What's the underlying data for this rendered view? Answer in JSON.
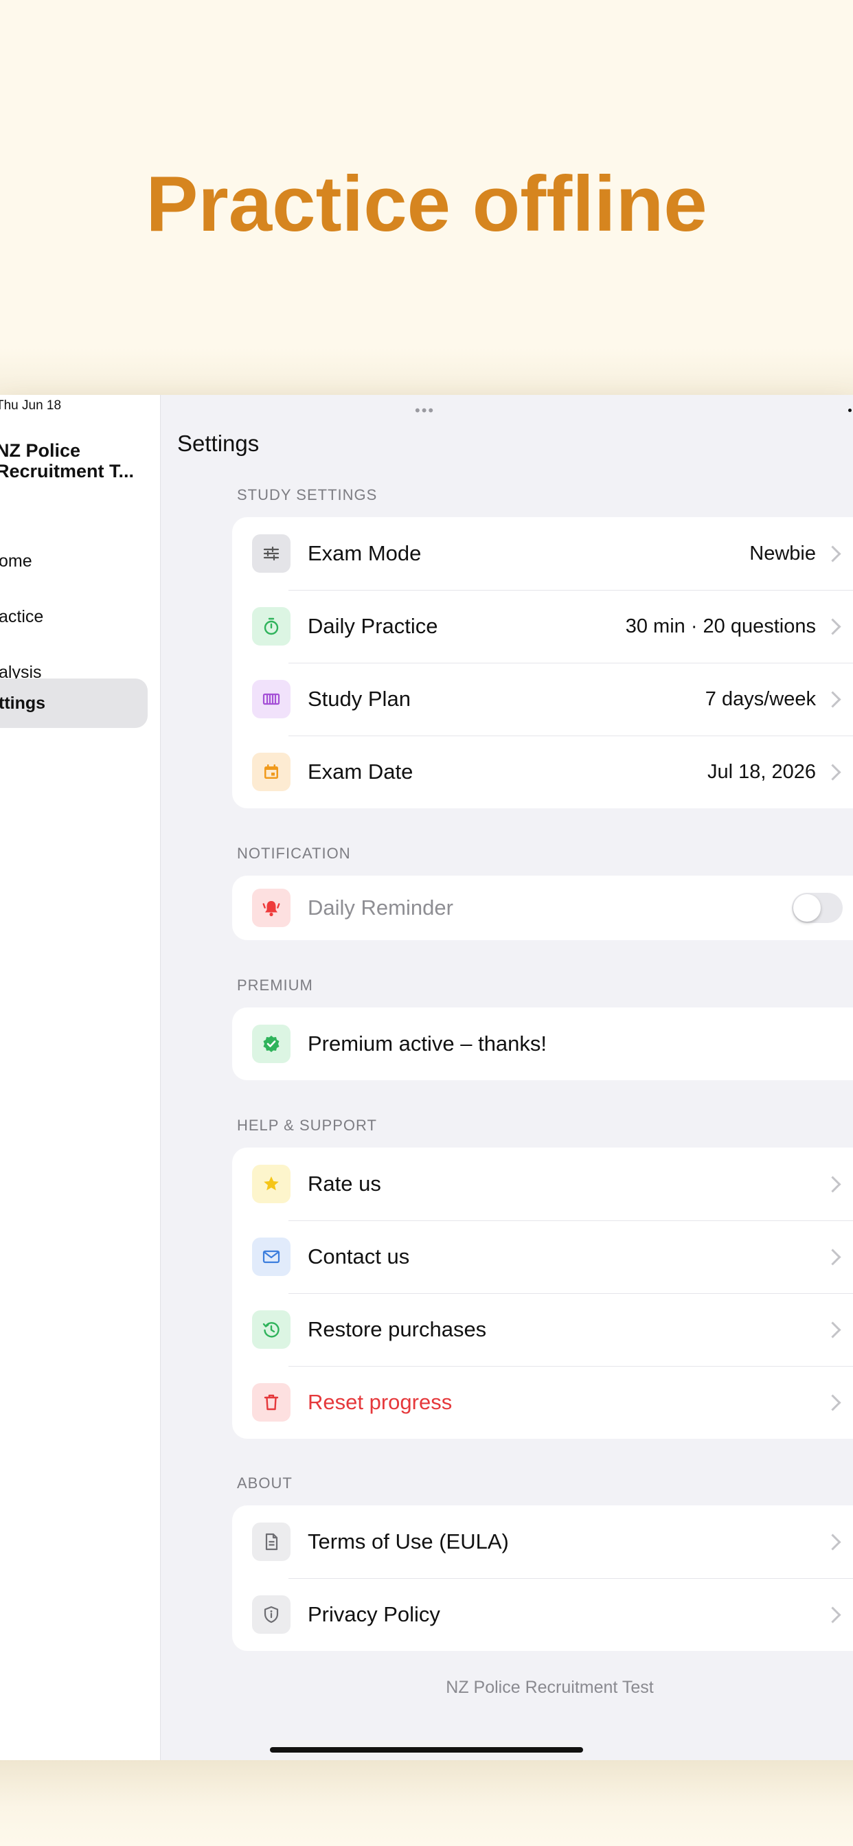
{
  "hero": {
    "title": "Practice offline"
  },
  "status": {
    "date": "Thu Jun 18"
  },
  "sidebar": {
    "app_title": "NZ Police Recruitment T...",
    "items": [
      {
        "label": "ome"
      },
      {
        "label": "actice"
      },
      {
        "label": "alysis"
      },
      {
        "label": "ttings"
      }
    ]
  },
  "main": {
    "title": "Settings",
    "sections": {
      "study": {
        "header": "STUDY SETTINGS",
        "rows": [
          {
            "label": "Exam Mode",
            "value": "Newbie",
            "icon": "sliders-icon"
          },
          {
            "label": "Daily Practice",
            "value": "30 min · 20 questions",
            "icon": "timer-icon"
          },
          {
            "label": "Study Plan",
            "value": "7 days/week",
            "icon": "calendar-grid-icon"
          },
          {
            "label": "Exam Date",
            "value": "Jul 18, 2026",
            "icon": "calendar-icon"
          }
        ]
      },
      "notification": {
        "header": "NOTIFICATION",
        "rows": [
          {
            "label": "Daily Reminder",
            "icon": "bell-icon",
            "toggle_on": false
          }
        ]
      },
      "premium": {
        "header": "PREMIUM",
        "rows": [
          {
            "label": "Premium active – thanks!",
            "icon": "verified-badge-icon"
          }
        ]
      },
      "help": {
        "header": "HELP & SUPPORT",
        "rows": [
          {
            "label": "Rate us",
            "icon": "star-icon"
          },
          {
            "label": "Contact us",
            "icon": "envelope-icon"
          },
          {
            "label": "Restore purchases",
            "icon": "history-icon"
          },
          {
            "label": "Reset progress",
            "icon": "trash-icon"
          }
        ]
      },
      "about": {
        "header": "ABOUT",
        "rows": [
          {
            "label": "Terms of Use (EULA)",
            "icon": "document-icon"
          },
          {
            "label": "Privacy Policy",
            "icon": "shield-icon"
          }
        ]
      }
    },
    "footer": "NZ Police Recruitment Test"
  },
  "colors": {
    "hero_title": "#d6851f",
    "destructive": "#e5383b",
    "disabled_text": "#8e8e93",
    "sliders_bg": "#e4e4e8",
    "timer_bg": "#dcf5e3",
    "plan_bg": "#f1e2fb",
    "date_bg": "#fdebd2",
    "bell_bg": "#fde0e0",
    "premium_bg": "#dcf5e3",
    "star_bg": "#fdf5cc",
    "mail_bg": "#e1ebfb",
    "restore_bg": "#dcf5e3",
    "trash_bg": "#fde0e0",
    "doc_bg": "#ececee",
    "shield_bg": "#ececee"
  }
}
